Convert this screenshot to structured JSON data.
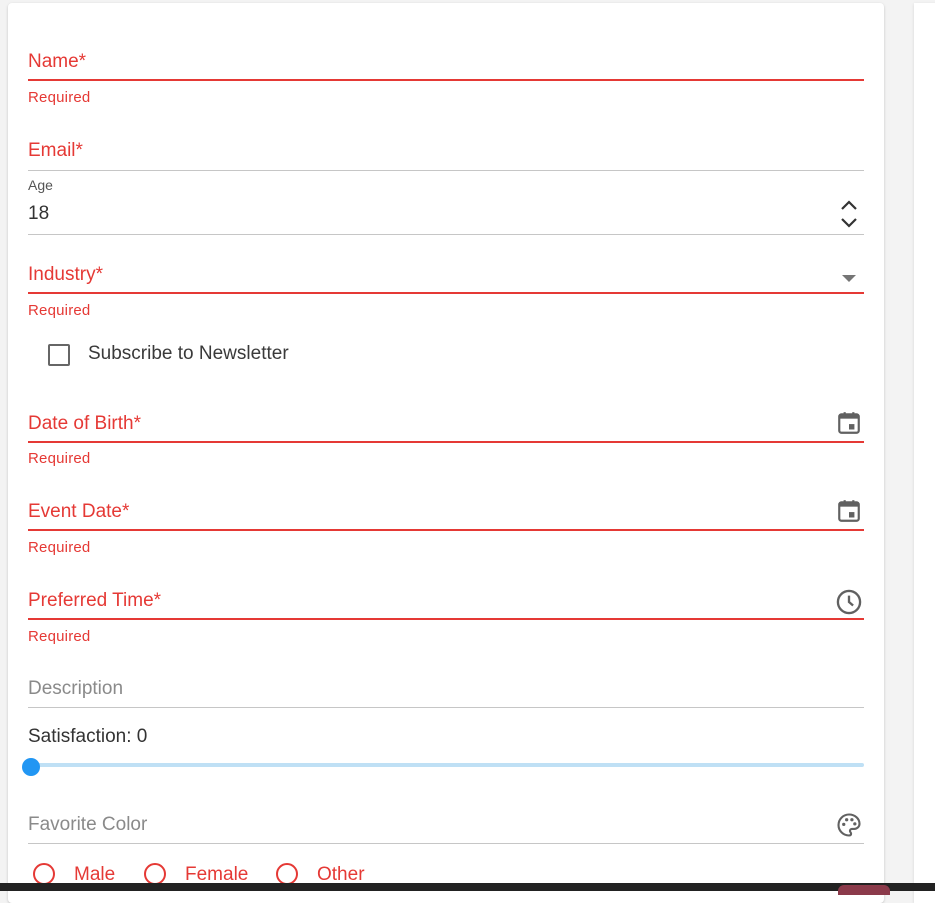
{
  "colors": {
    "error": "#e53935",
    "accent": "#2196f3",
    "track": "#bfe0f5"
  },
  "form": {
    "name": {
      "label": "Name*",
      "helper": "Required"
    },
    "email": {
      "label": "Email*"
    },
    "age": {
      "label": "Age",
      "value": "18"
    },
    "industry": {
      "label": "Industry*",
      "helper": "Required",
      "icon": "dropdown-arrow-icon"
    },
    "newsletter": {
      "label": "Subscribe to Newsletter",
      "checked": false
    },
    "dob": {
      "label": "Date of Birth*",
      "helper": "Required",
      "icon": "calendar-icon"
    },
    "event_date": {
      "label": "Event Date*",
      "helper": "Required",
      "icon": "calendar-icon"
    },
    "preferred_time": {
      "label": "Preferred Time*",
      "helper": "Required",
      "icon": "clock-icon"
    },
    "description": {
      "label": "Description"
    },
    "satisfaction": {
      "label": "Satisfaction: 0",
      "value": 0
    },
    "favorite_color": {
      "label": "Favorite Color",
      "icon": "palette-icon"
    },
    "gender": {
      "options": [
        {
          "label": "Male"
        },
        {
          "label": "Female"
        },
        {
          "label": "Other"
        }
      ]
    }
  }
}
